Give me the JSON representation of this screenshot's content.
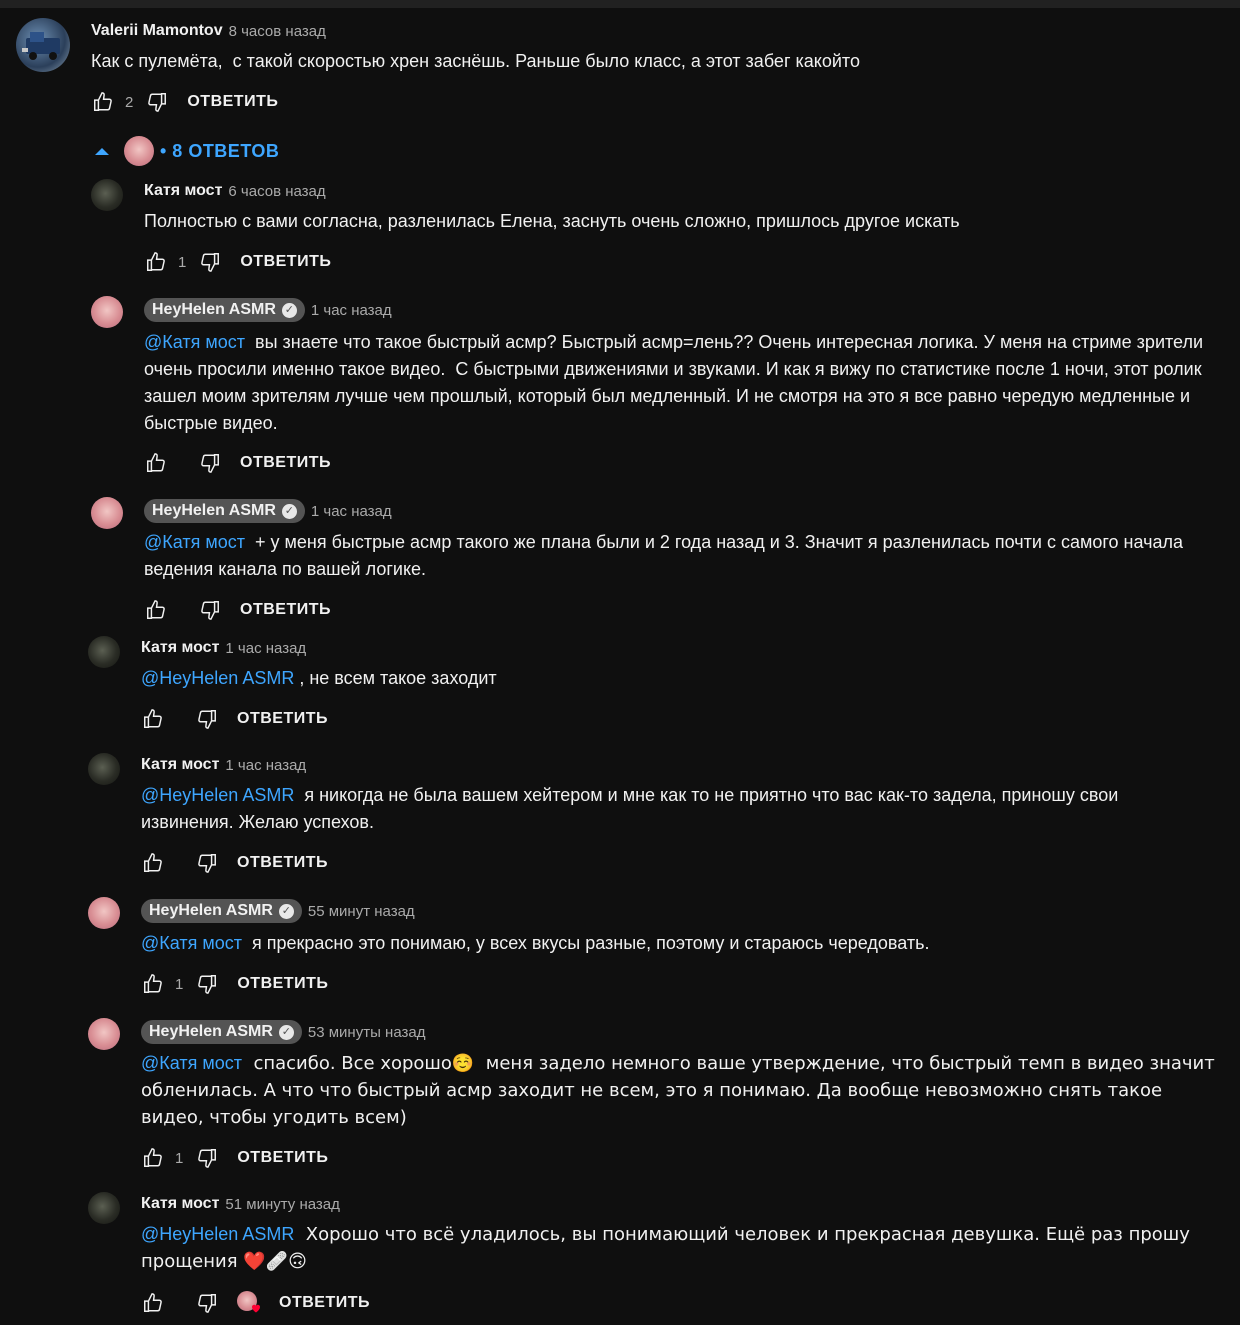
{
  "reply_label": "ОТВЕТИТЬ",
  "main": {
    "author": "Valerii Mamontov",
    "time": "8 часов назад",
    "text": "Как с пулемёта,  с такой скоростью хрен заснёшь. Раньше было класс, а этот забег какойто",
    "likes": "2"
  },
  "replies_toggle": {
    "label": "• 8 ОТВЕТОВ"
  },
  "replies": [
    {
      "author": "Катя мост",
      "time": "6 часов назад",
      "mention": "",
      "text": "Полностью с вами согласна, разленилась Елена, заснуть очень сложно, пришлось другое искать",
      "likes": "1"
    },
    {
      "author": "HeyHelen ASMR",
      "time": "1 час назад",
      "mention": "@Катя мост",
      "text": "  вы знаете что такое быстрый асмр? Быстрый асмр=лень?? Очень интересная логика. У меня на стриме зрители очень просили именно такое видео.  С быстрыми движениями и звуками. И как я вижу по статистике после 1 ночи, этот ролик зашел моим зрителям лучше чем прошлый, который был медленный. И не смотря на это я все равно чередую медленные и быстрые видео.",
      "likes": ""
    },
    {
      "author": "HeyHelen ASMR",
      "time": "1 час назад",
      "mention": "@Катя мост",
      "text": "  + у меня быстрые асмр такого же плана были и 2 года назад и 3. Значит я разленилась почти с самого начала ведения канала по вашей логике.",
      "likes": ""
    },
    {
      "author": "Катя мост",
      "time": "1 час назад",
      "mention": "@HeyHelen ASMR",
      "text": " , не всем такое заходит",
      "likes": ""
    },
    {
      "author": "Катя мост",
      "time": "1 час назад",
      "mention": "@HeyHelen ASMR",
      "text": "  я никогда не была вашем хейтером и мне как то не приятно что вас как-то задела, приношу свои извинения. Желаю успехов.",
      "likes": ""
    },
    {
      "author": "HeyHelen ASMR",
      "time": "55 минут назад",
      "mention": "@Катя мост",
      "text": "  я прекрасно это понимаю, у всех вкусы разные, поэтому и стараюсь чередовать.",
      "likes": "1"
    },
    {
      "author": "HeyHelen ASMR",
      "time": "53 минуты назад",
      "mention": "@Катя мост",
      "text": "  спасибо. Все хорошо☺️  меня задело немного ваше утверждение, что быстрый темп в видео значит обленилась. А что что быстрый асмр заходит не всем, это я понимаю. Да вообще невозможно снять такое видео, чтобы угодить всем)",
      "likes": "1"
    },
    {
      "author": "Катя мост",
      "time": "51 минуту назад",
      "mention": "@HeyHelen ASMR",
      "text": "  Хорошо что всё уладилось, вы понимающий человек и прекрасная девушка. Ещё раз прошу прощения ❤️🩹🙃",
      "likes": ""
    }
  ],
  "icons": {
    "like": "thumbs-up-icon",
    "dislike": "thumbs-down-icon",
    "collapse": "caret-up-icon",
    "check": "verified-check-icon",
    "creator_heart": "creator-heart-icon"
  },
  "colors": {
    "background": "#0f0f0f",
    "link": "#3ea6ff",
    "muted": "#aaaaaa",
    "badge": "#545454"
  }
}
